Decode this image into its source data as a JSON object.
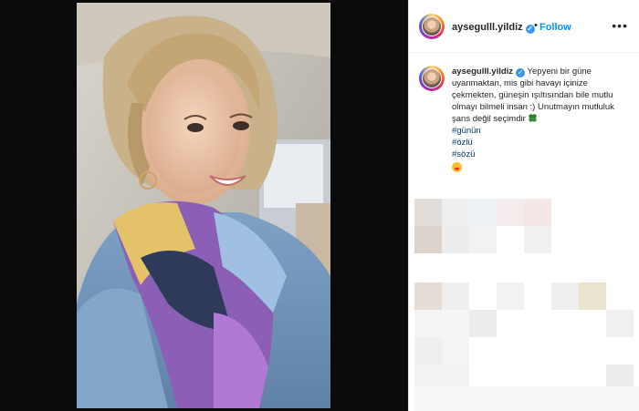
{
  "post": {
    "username": "aysegulll.yildiz",
    "verified_icon": "verified-badge-icon",
    "separator": "•",
    "follow_label": "Follow",
    "more_icon": "more-options-icon",
    "more_glyph": "•••"
  },
  "caption": {
    "username": "aysegulll.yildiz",
    "text": "Yepyeni bir güne uyanmaktan, mis gibi havayı içinize çekmekten, güneşin ışıltısından bile mutlu olmayı bilmeli insan :) Unutmayın mutluluk şans değil seçimdir",
    "clover_icon": "four-leaf-clover-icon",
    "hashtags": [
      "#günün",
      "#özlü",
      "#sözü"
    ],
    "emoji_icon": "tongue-out-emoji-icon"
  },
  "colors": {
    "follow": "#0095f6",
    "hashtag": "#00376b",
    "verified": "#3897f0",
    "backdrop": "#0b0b0d"
  }
}
